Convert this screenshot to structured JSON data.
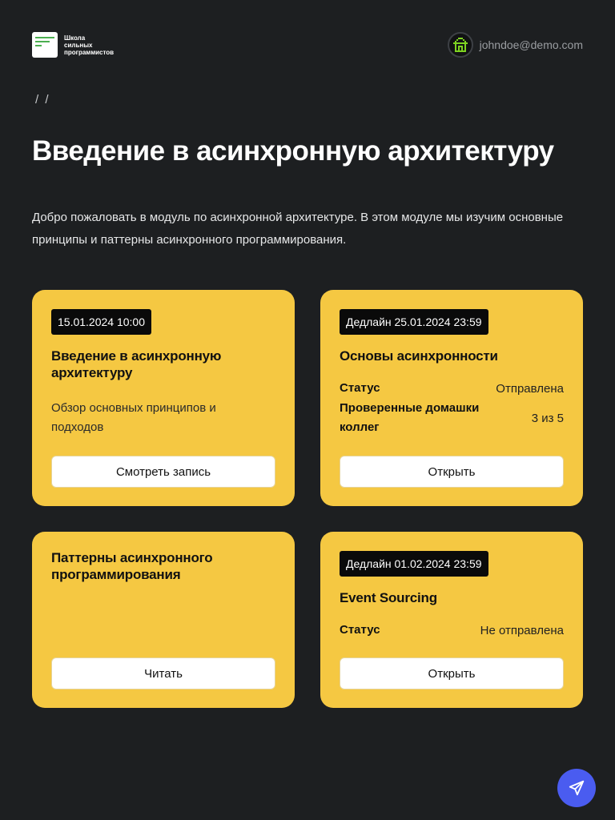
{
  "logo": {
    "text_line1": "Школа",
    "text_line2": "сильных",
    "text_line3": "программистов"
  },
  "user": {
    "email": "johndoe@demo.com",
    "avatar_icon": "pixel-house-icon",
    "avatar_color": "#7ed321"
  },
  "breadcrumb": "/ /",
  "page": {
    "title": "Введение в асинхронную архитектуру",
    "intro": "Добро пожаловать в модуль по асинхронной архитектуре. В этом модуле мы изучим основные принципы и паттерны асинхронного программирования."
  },
  "cards": [
    {
      "badge": "15.01.2024 10:00",
      "title": "Введение в асинхронную архитектуру",
      "description": "Обзор основных принципов и подходов",
      "button": "Смотреть запись"
    },
    {
      "badge": "Дедлайн 25.01.2024 23:59",
      "title": "Основы асинхронности",
      "status_label": "Статус",
      "status_value": "Отправлена",
      "reviews_label": "Проверенные домашки коллег",
      "reviews_value": "3 из 5",
      "button": "Открыть"
    },
    {
      "title": "Паттерны асинхронного программирования",
      "button": "Читать"
    },
    {
      "badge": "Дедлайн 01.02.2024 23:59",
      "title": "Event Sourcing",
      "status_label": "Статус",
      "status_value": "Не отправлена",
      "button": "Открыть"
    }
  ],
  "fab": {
    "icon": "send-icon"
  },
  "colors": {
    "background": "#1d1f21",
    "card": "#f5c842",
    "badge": "#0a0a0a",
    "fab": "#4a5cf0",
    "logo_accent": "#4caf50"
  }
}
